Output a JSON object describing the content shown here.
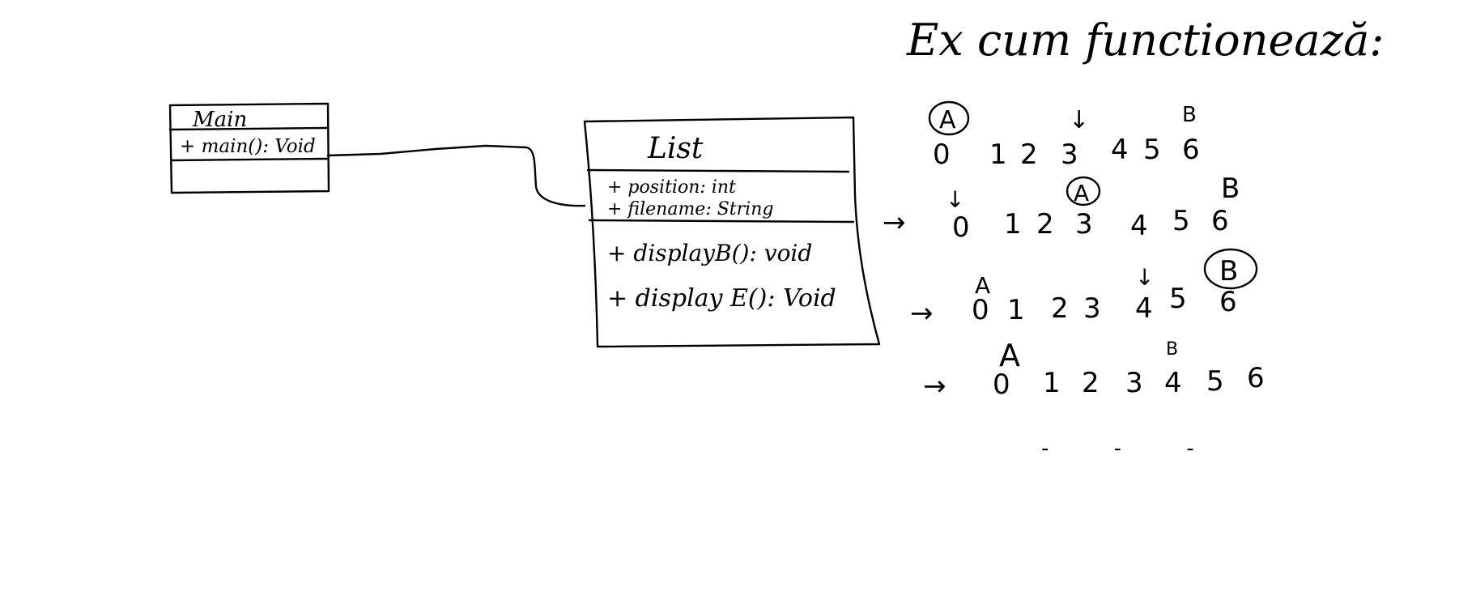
{
  "main_class": {
    "name": "Main",
    "methods": [
      "+ main(): Void"
    ]
  },
  "list_class": {
    "name": "List",
    "attributes": [
      "+ position: int",
      "+ filename: String"
    ],
    "methods": [
      "+ displayB(): void",
      "+ display E(): Void"
    ]
  },
  "example": {
    "title": "Ex cum functionează:",
    "digits": [
      "0",
      "1",
      "2",
      "3",
      "4",
      "5",
      "6"
    ],
    "pointer_a_label": "A",
    "pointer_b_label": "B",
    "step_arrow": "→",
    "down_arrow": "↓",
    "ellipsis": "- - -"
  }
}
